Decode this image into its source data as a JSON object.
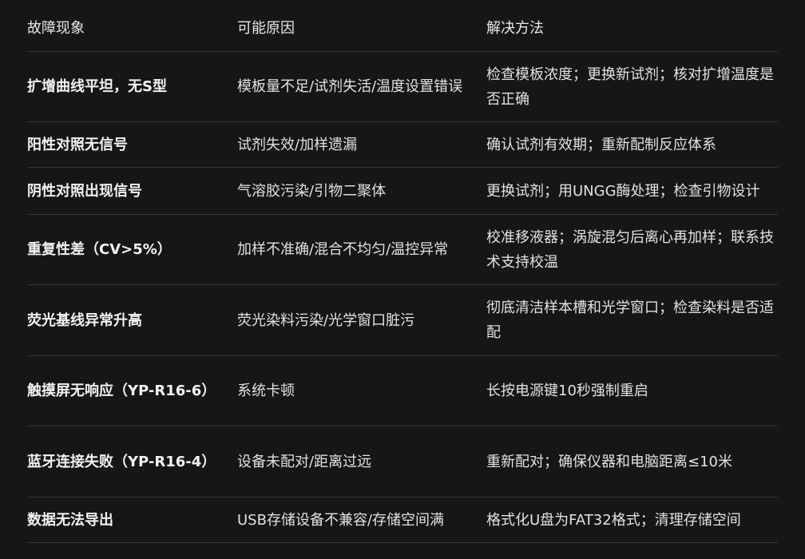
{
  "table": {
    "headers": [
      "故障现象",
      "可能原因",
      "解决方法"
    ],
    "rows": [
      {
        "symptom": "扩增曲线平坦，无S型",
        "cause": "模板量不足/试剂失活/温度设置错误",
        "solution": "检查模板浓度；更换新试剂；核对扩增温度是否正确"
      },
      {
        "symptom": "阳性对照无信号",
        "cause": "试剂失效/加样遗漏",
        "solution": "确认试剂有效期；重新配制反应体系"
      },
      {
        "symptom": "阴性对照出现信号",
        "cause": "气溶胶污染/引物二聚体",
        "solution": "更换试剂；用UNGG酶处理；检查引物设计"
      },
      {
        "symptom": "重复性差（CV>5%）",
        "cause": "加样不准确/混合不均匀/温控异常",
        "solution": "校准移液器；涡旋混匀后离心再加样；联系技术支持校温"
      },
      {
        "symptom": "荧光基线异常升高",
        "cause": "荧光染料污染/光学窗口脏污",
        "solution": "彻底清洁样本槽和光学窗口；检查染料是否适配"
      },
      {
        "symptom": "触摸屏无响应（YP-R16-6）",
        "cause": "系统卡顿",
        "solution": "长按电源键10秒强制重启"
      },
      {
        "symptom": "蓝牙连接失败（YP-R16-4）",
        "cause": "设备未配对/距离过远",
        "solution": "重新配对；确保仪器和电脑距离≤10米"
      },
      {
        "symptom": "数据无法导出",
        "cause": "USB存储设备不兼容/存储空间满",
        "solution": "格式化U盘为FAT32格式；清理存储空间"
      }
    ]
  }
}
